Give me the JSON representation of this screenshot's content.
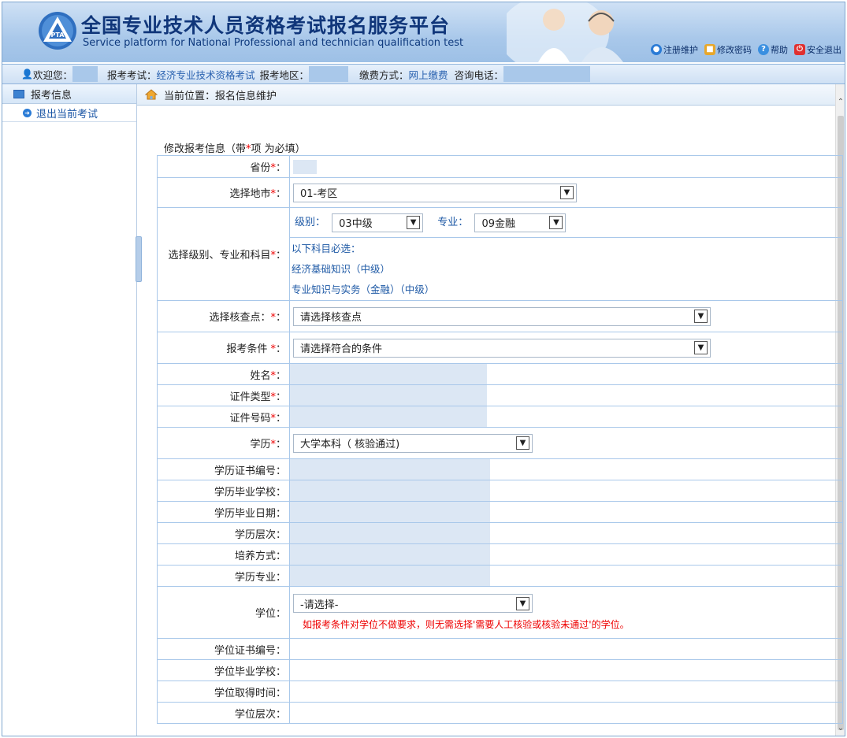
{
  "header": {
    "title_cn": "全国专业技术人员资格考试报名服务平台",
    "title_en": "Service platform for National Professional and technician qualification test",
    "links": [
      {
        "label": "注册维护",
        "icon": "globe-icon",
        "color": "#2a7bd6"
      },
      {
        "label": "修改密码",
        "icon": "lock-icon",
        "color": "#e8a72a"
      },
      {
        "label": "帮助",
        "icon": "help-icon",
        "color": "#3a8fe0"
      },
      {
        "label": "安全退出",
        "icon": "power-icon",
        "color": "#e03030"
      }
    ]
  },
  "infobar": {
    "welcome": "欢迎您：",
    "exam_label": "报考考试：",
    "exam_value": "经济专业技术资格考试",
    "region_label": "报考地区：",
    "pay_label": "缴费方式：",
    "pay_value": "网上缴费",
    "phone_label": "咨询电话："
  },
  "sidebar": {
    "header": "报考信息",
    "items": [
      {
        "label": "退出当前考试"
      }
    ]
  },
  "breadcrumb": {
    "text": "当前位置：报名信息维护"
  },
  "form": {
    "title": "修改报考信息（带",
    "title_star": "*",
    "title_tail": "项 为必填）",
    "province_label": "省份",
    "city_label": "选择地市",
    "city_value": "01-考区",
    "level_subject_label": "选择级别、专业和科目",
    "level_label": "级别：",
    "level_value": "03中级",
    "major_label": "专业：",
    "major_value": "09金融",
    "subjects_note": "以下科目必选：",
    "subjects": [
      "经济基础知识（中级）",
      "专业知识与实务（金融）（中级）"
    ],
    "checkpoint_label": "选择核查点：",
    "checkpoint_placeholder": "请选择核查点",
    "condition_label": "报考条件",
    "condition_placeholder": "请选择符合的条件",
    "name_label": "姓名",
    "id_type_label": "证件类型",
    "id_number_label": "证件号码",
    "education_label": "学历",
    "education_value": "大学本科（ 核验通过)",
    "edu_fields": [
      "学历证书编号：",
      "学历毕业学校：",
      "学历毕业日期：",
      "学历层次：",
      "培养方式：",
      "学历专业："
    ],
    "degree_label": "学位：",
    "degree_value": "-请选择-",
    "degree_warning": "如报考条件对学位不做要求，则无需选择'需要人工核验或核验未通过'的学位。",
    "degree_fields": [
      "学位证书编号：",
      "学位毕业学校：",
      "学位取得时间：",
      "学位层次："
    ]
  }
}
